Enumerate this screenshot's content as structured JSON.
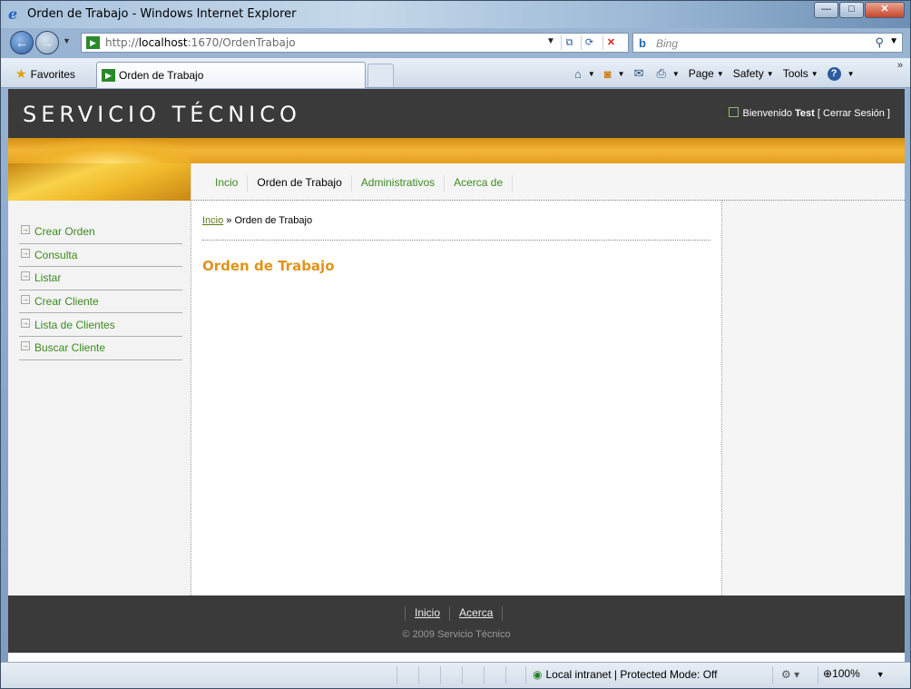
{
  "window": {
    "title": "Orden de Trabajo - Windows Internet Explorer",
    "controls": {
      "minimize": "—",
      "maximize": "□",
      "close": "✕"
    }
  },
  "address_bar": {
    "url_prefix": "http://",
    "url_host": "localhost",
    "url_rest": ":1670/OrdenTrabajo"
  },
  "search": {
    "placeholder": "Bing"
  },
  "favorites": {
    "label": "Favorites"
  },
  "tab": {
    "label": "Orden de Trabajo"
  },
  "command_bar": {
    "page": "Page",
    "safety": "Safety",
    "tools": "Tools"
  },
  "site": {
    "title": "SERVICIO TÉCNICO",
    "login": {
      "greeting": "Bienvenido",
      "user": "Test",
      "logout_open": "[ ",
      "logout": "Cerrar Sesión",
      "logout_close": " ]"
    }
  },
  "menu": {
    "items": [
      {
        "label": "Incio",
        "selected": false
      },
      {
        "label": "Orden de Trabajo",
        "selected": true
      },
      {
        "label": "Administrativos",
        "selected": false
      },
      {
        "label": "Acerca de",
        "selected": false
      }
    ]
  },
  "sidebar": {
    "items": [
      {
        "label": "Crear Orden"
      },
      {
        "label": "Consulta"
      },
      {
        "label": "Listar"
      },
      {
        "label": "Crear Cliente"
      },
      {
        "label": "Lista de Clientes"
      },
      {
        "label": "Buscar Cliente"
      }
    ]
  },
  "breadcrumb": {
    "home": "Incio",
    "separator": " » ",
    "current": "Orden de Trabajo"
  },
  "main": {
    "title": "Orden de Trabajo"
  },
  "footer": {
    "links": [
      {
        "label": "Inicio"
      },
      {
        "label": "Acerca"
      }
    ],
    "copyright": "© 2009 Servicio Técnico"
  },
  "status_bar": {
    "zone": "Local intranet | Protected Mode: Off",
    "zoom": "100%"
  },
  "colors": {
    "header_bg": "#3a3a3a",
    "accent_orange": "#e0941a",
    "link_green": "#3b8a20"
  }
}
